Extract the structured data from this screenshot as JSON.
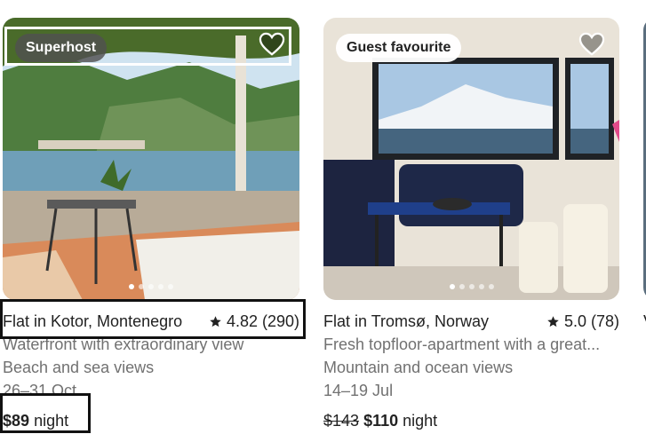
{
  "listings": [
    {
      "badge": "Superhost",
      "title": "Flat in Kotor, Montenegro",
      "rating": "4.82 (290)",
      "description": "Waterfront with extraordinary view",
      "views": "Beach and sea views",
      "dates": "26–31 Oct",
      "price": "$89",
      "price_unit": "night",
      "photo_dots": 5,
      "active_dot": 0
    },
    {
      "badge": "Guest favourite",
      "title": "Flat in Tromsø, Norway",
      "rating": "5.0 (78)",
      "description": "Fresh topfloor-apartment with a great...",
      "views": "Mountain and ocean views",
      "dates": "14–19 Jul",
      "original_price": "$143",
      "price": "$110",
      "price_unit": "night",
      "photo_dots": 5,
      "active_dot": 0
    },
    {
      "title": "V"
    }
  ],
  "icons": {
    "wishlist": "heart-outline-icon",
    "rating": "star-icon"
  },
  "colors": {
    "text_primary": "#222222",
    "text_secondary": "#717171",
    "highlight_box": "#111111"
  }
}
